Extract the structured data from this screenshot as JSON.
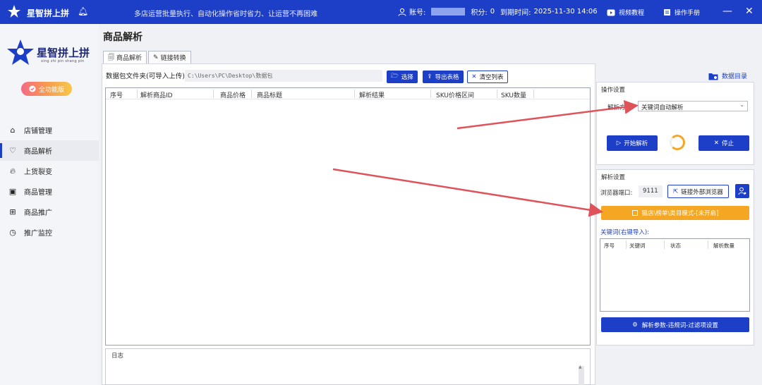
{
  "topbar": {
    "app_name": "星智拼上拼",
    "slogan": "多店运营批量执行、自动化操作省时省力、让运营不再困难",
    "account_label": "账号:",
    "points_label": "积分:",
    "points_value": "0",
    "expiry_label": "到期时间:",
    "expiry_value": "2025-11-30 14:06",
    "video_tutorial": "视频教程",
    "manual": "操作手册",
    "minimize": "—",
    "close": "✕"
  },
  "sidebar": {
    "brand_name": "星智拼上拼",
    "brand_sub": "xing zhi pin shang pin",
    "badge": "全功能版",
    "items": [
      {
        "label": "店铺管理",
        "icon": "home-icon",
        "active": false
      },
      {
        "label": "商品解析",
        "icon": "heart-icon",
        "active": true
      },
      {
        "label": "上货裂变",
        "icon": "fire-icon",
        "active": false
      },
      {
        "label": "商品管理",
        "icon": "wallet-icon",
        "active": false
      },
      {
        "label": "商品推广",
        "icon": "grid-icon",
        "active": false
      },
      {
        "label": "推广监控",
        "icon": "clock-icon",
        "active": false
      }
    ]
  },
  "main": {
    "page_title": "商品解析",
    "tabs": [
      {
        "label": "商品解析",
        "active": true
      },
      {
        "label": "链接转换",
        "active": false
      }
    ],
    "folder_label": "数据包文件夹(可导入上传):",
    "folder_path": "C:\\Users\\PC\\Desktop\\数据包",
    "select_btn": "选择",
    "export_btn": "导出表格",
    "clear_btn": "清空列表",
    "table_columns": [
      "序号",
      "解析商品ID",
      "商品价格",
      "商品标题",
      "解析结果",
      "SKU价格区间",
      "SKU数量"
    ],
    "log_label": "日志"
  },
  "right": {
    "data_dir": "数据目录",
    "op_title": "操作设置",
    "parse_mode_label": "解析方式:",
    "parse_mode_value": "关键词自动解析",
    "start_btn": "开始解析",
    "stop_btn": "停止",
    "parse_settings_title": "解析设置",
    "port_label": "浏览器端口:",
    "port_value": "9111",
    "link_browser_btn": "链接外部浏览器",
    "mode_btn": "猫店\\榜单\\类目模式-[未开启]",
    "keywords_label": "关键词(右键导入):",
    "kw_columns": [
      "序号",
      "关键词",
      "状态",
      "解析数量"
    ],
    "filter_btn": "解析参数-违规词-过滤项设置"
  },
  "colors": {
    "primary": "#1d3ec7",
    "orange": "#f5a623",
    "arrow": "#e0525a"
  }
}
